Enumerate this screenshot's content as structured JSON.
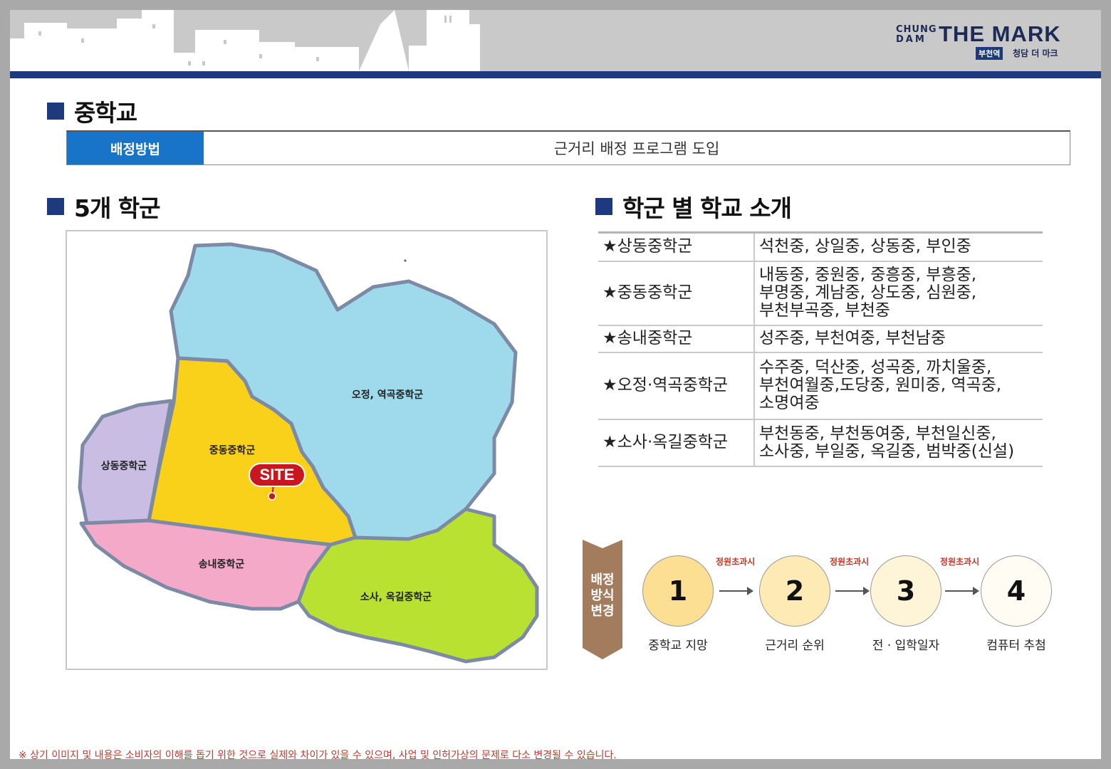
{
  "logo": {
    "line1": "CHUNG",
    "line2": "DAM",
    "name": "THE MARK",
    "station": "부천역",
    "brand_kr": "청담 더 마크"
  },
  "middle_school": {
    "title": "중학교",
    "assign_label": "배정방법",
    "assign_value": "근거리 배정 프로그램 도입"
  },
  "districts_section": {
    "title": "5개 학군",
    "map_labels": {
      "ojeong": "오정, 역곡중학군",
      "jungdong": "중동중학군",
      "sangdong": "상동중학군",
      "songnae": "송내중학군",
      "sosa": "소사, 옥길중학군",
      "site": "SITE"
    },
    "colors": {
      "ojeong": "#9fd9ec",
      "jungdong": "#f9d11a",
      "sangdong": "#c9bde3",
      "songnae": "#f4a9c9",
      "sosa": "#b9e132",
      "border": "#7c8aa5",
      "site": "#c8171e"
    }
  },
  "intro_section": {
    "title": "학군 별 학교 소개",
    "rows": [
      {
        "district": "★상동중학군",
        "schools": [
          "석천중, 상일중, 상동중, 부인중"
        ]
      },
      {
        "district": "★중동중학군",
        "schools": [
          "내동중, 중원중, 중흥중, 부흥중,",
          "부명중, 계남중, 상도중, 심원중,",
          "부천부곡중, 부천중"
        ]
      },
      {
        "district": "★송내중학군",
        "schools": [
          "성주중, 부천여중, 부천남중"
        ]
      },
      {
        "district": "★오정·역곡중학군",
        "schools": [
          "수주중, 덕산중, 성곡중, 까치울중,",
          "부천여월중,도당중, 원미중, 역곡중,",
          "소명여중"
        ]
      },
      {
        "district": "★소사·옥길중학군",
        "schools": [
          "부천동중, 부천동여중, 부천일신중,",
          "소사중, 부일중, 옥길중, 범박중(신설)"
        ]
      }
    ]
  },
  "flow": {
    "label": [
      "배정",
      "방식",
      "변경"
    ],
    "over_capacity": "정원초과시",
    "steps": [
      {
        "num": "1",
        "caption": "중학교 지망",
        "color": "#fddf94"
      },
      {
        "num": "2",
        "caption": "근거리 순위",
        "color": "#feeab4"
      },
      {
        "num": "3",
        "caption": "전 · 입학일자",
        "color": "#fef4d8"
      },
      {
        "num": "4",
        "caption": "컴퓨터 추첨",
        "color": "#fffcf3"
      }
    ]
  },
  "footnote": "※ 상기 이미지 및 내용은 소비자의 이해를 돕기 위한 것으로 실제와 차이가 있을 수 있으며, 사업 및 인허가상의 문제로 다소 변경될 수 있습니다."
}
